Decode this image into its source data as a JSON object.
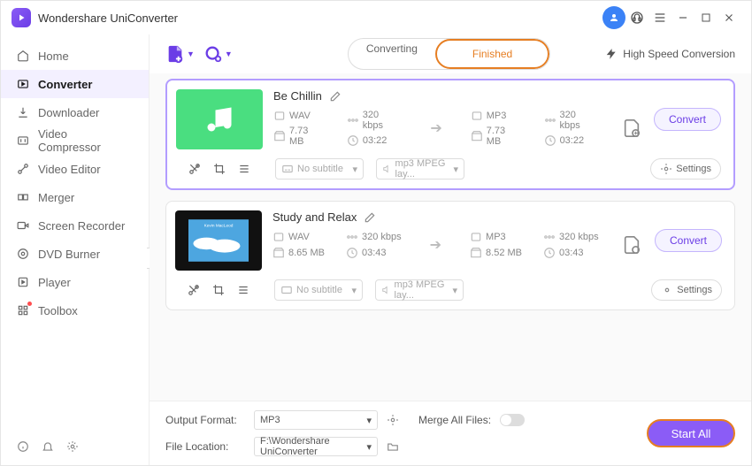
{
  "app": {
    "title": "Wondershare UniConverter"
  },
  "sidebar": {
    "items": [
      {
        "label": "Home"
      },
      {
        "label": "Converter"
      },
      {
        "label": "Downloader"
      },
      {
        "label": "Video Compressor"
      },
      {
        "label": "Video Editor"
      },
      {
        "label": "Merger"
      },
      {
        "label": "Screen Recorder"
      },
      {
        "label": "DVD Burner"
      },
      {
        "label": "Player"
      },
      {
        "label": "Toolbox"
      }
    ]
  },
  "toolbar": {
    "seg": {
      "converting": "Converting",
      "finished": "Finished"
    },
    "high_speed": "High Speed Conversion"
  },
  "cards": [
    {
      "title": "Be Chillin",
      "src": {
        "fmt": "WAV",
        "bitrate": "320 kbps",
        "size": "7.73 MB",
        "dur": "03:22"
      },
      "dst": {
        "fmt": "MP3",
        "bitrate": "320 kbps",
        "size": "7.73 MB",
        "dur": "03:22"
      },
      "subtitle": "No subtitle",
      "audio": "mp3 MPEG lay...",
      "settings": "Settings",
      "convert": "Convert"
    },
    {
      "title": "Study and Relax",
      "src": {
        "fmt": "WAV",
        "bitrate": "320 kbps",
        "size": "8.65 MB",
        "dur": "03:43"
      },
      "dst": {
        "fmt": "MP3",
        "bitrate": "320 kbps",
        "size": "8.52 MB",
        "dur": "03:43"
      },
      "subtitle": "No subtitle",
      "audio": "mp3 MPEG lay...",
      "settings": "Settings",
      "convert": "Convert"
    }
  ],
  "footer": {
    "output_format_label": "Output Format:",
    "output_format": "MP3",
    "merge_label": "Merge All Files:",
    "file_location_label": "File Location:",
    "file_location": "F:\\Wondershare UniConverter",
    "start_all": "Start All"
  }
}
